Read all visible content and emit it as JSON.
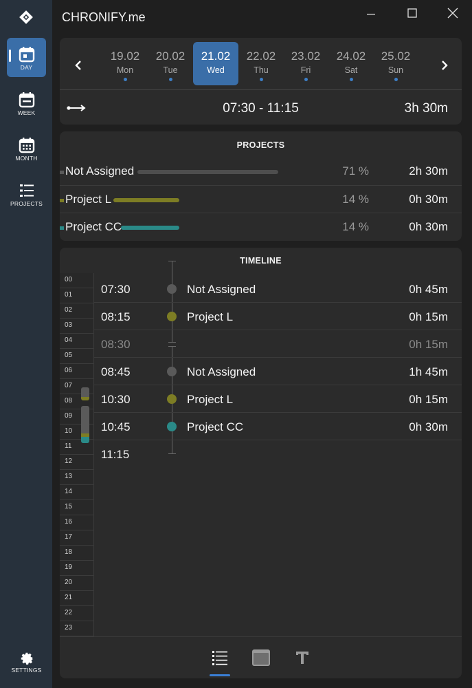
{
  "app": {
    "title": "CHRONIFY.me"
  },
  "colors": {
    "accent": "#3a6ea8",
    "not_assigned": "#5a5a5a",
    "project_l": "#7d7d24",
    "project_cc": "#2a8a88"
  },
  "sidebar": {
    "items": [
      {
        "label": "DAY",
        "icon": "calendar-day-icon",
        "active": true
      },
      {
        "label": "WEEK",
        "icon": "calendar-week-icon",
        "active": false
      },
      {
        "label": "MONTH",
        "icon": "calendar-month-icon",
        "active": false
      },
      {
        "label": "PROJECTS",
        "icon": "list-icon",
        "active": false
      }
    ],
    "settings_label": "SETTINGS"
  },
  "dates": {
    "days": [
      {
        "date": "19.02",
        "name": "Mon"
      },
      {
        "date": "20.02",
        "name": "Tue"
      },
      {
        "date": "21.02",
        "name": "Wed",
        "selected": true
      },
      {
        "date": "22.02",
        "name": "Thu"
      },
      {
        "date": "23.02",
        "name": "Fri"
      },
      {
        "date": "24.02",
        "name": "Sat"
      },
      {
        "date": "25.02",
        "name": "Sun"
      }
    ],
    "range": "07:30 - 11:15",
    "total": "3h 30m"
  },
  "projects": {
    "header": "PROJECTS",
    "rows": [
      {
        "name": "Not Assigned",
        "percent": "71 %",
        "duration": "2h 30m",
        "share": 0.71
      },
      {
        "name": "Project L",
        "percent": "14 %",
        "duration": "0h 30m",
        "share": 0.14
      },
      {
        "name": "Project CC",
        "percent": "14 %",
        "duration": "0h 30m",
        "share": 0.14
      }
    ]
  },
  "timeline": {
    "header": "TIMELINE",
    "hours": [
      "00",
      "01",
      "02",
      "03",
      "04",
      "05",
      "06",
      "07",
      "08",
      "09",
      "10",
      "11",
      "12",
      "13",
      "14",
      "15",
      "16",
      "17",
      "18",
      "19",
      "20",
      "21",
      "22",
      "23"
    ],
    "entries": [
      {
        "time": "07:30",
        "name": "Not Assigned",
        "duration": "0h 45m"
      },
      {
        "time": "08:15",
        "name": "Project L",
        "duration": "0h 15m"
      },
      {
        "time": "08:30",
        "name": "",
        "duration": "0h 15m",
        "gap": true
      },
      {
        "time": "08:45",
        "name": "Not Assigned",
        "duration": "1h 45m"
      },
      {
        "time": "10:30",
        "name": "Project L",
        "duration": "0h 15m"
      },
      {
        "time": "10:45",
        "name": "Project CC",
        "duration": "0h 30m"
      },
      {
        "time": "11:15",
        "name": "",
        "duration": ""
      }
    ]
  },
  "toolbar": {
    "buttons": [
      "list-view-icon",
      "card-view-icon",
      "text-view-icon"
    ],
    "active": "list-view-icon"
  }
}
